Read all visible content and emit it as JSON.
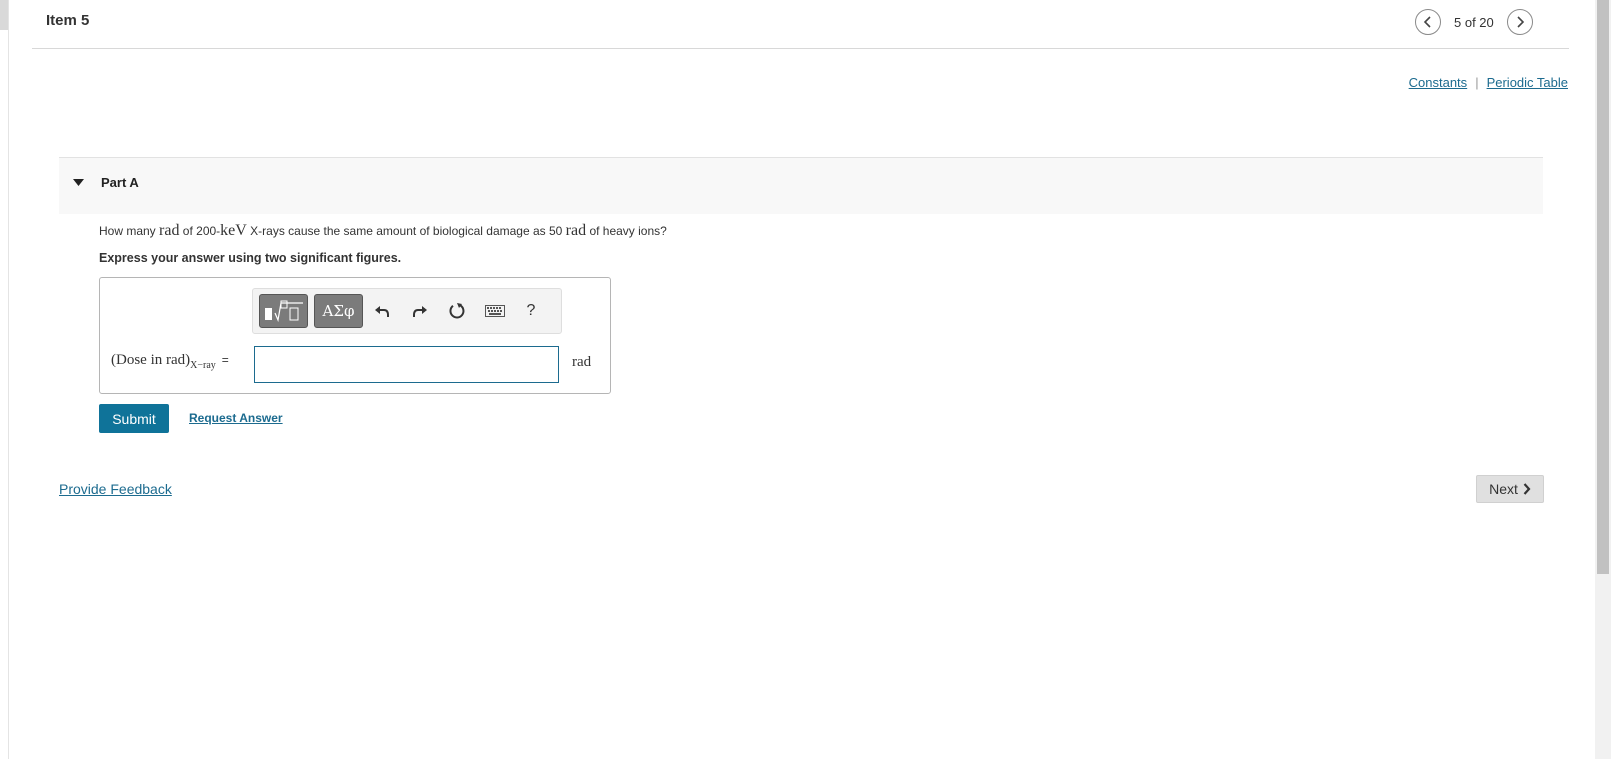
{
  "header": {
    "title": "Item 5",
    "pager_text": "5 of 20",
    "prev_icon": "chevron-left-icon",
    "next_icon": "chevron-right-icon"
  },
  "resources": {
    "constants_label": "Constants",
    "separator": "|",
    "periodic_table_label": "Periodic Table"
  },
  "part": {
    "label": "Part A",
    "expanded": true,
    "question": {
      "t1": "How many ",
      "m1": "rad",
      "t2": " of 200-",
      "m2": "keV",
      "t3": " X-rays cause the same amount of biological damage as 50 ",
      "m3": "rad",
      "t4": " of heavy ions?"
    },
    "instruction": "Express your answer using two significant figures."
  },
  "answer": {
    "label_main": "(Dose in rad)",
    "label_sub": "X−ray",
    "equals": "=",
    "value": "",
    "unit": "rad",
    "toolbar": {
      "symbols_label": "ΑΣφ",
      "help_label": "?"
    }
  },
  "actions": {
    "submit_label": "Submit",
    "request_answer_label": "Request Answer",
    "feedback_label": "Provide Feedback",
    "next_label": "Next"
  },
  "colors": {
    "link": "#1c6b8f",
    "submit_bg": "#0f7399",
    "next_bg": "#e0e0e0"
  }
}
